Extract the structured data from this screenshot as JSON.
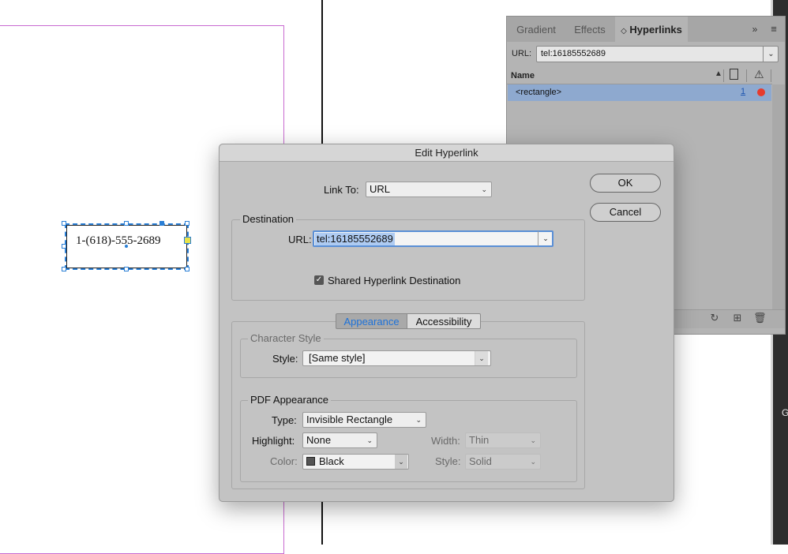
{
  "canvas": {
    "phone_text": "1-(618)-555-2689",
    "strip_char": "G"
  },
  "panel": {
    "tabs": [
      "Gradient",
      "Effects",
      "Hyperlinks"
    ],
    "active_tab_marker": "◇",
    "more_icon": "»",
    "menu_icon": "≡",
    "url_label": "URL:",
    "url_value": "tel:16185552689",
    "name_header": "Name",
    "rows": [
      {
        "name": "<rectangle>",
        "page": "1",
        "status_color": "#e63b2e"
      }
    ],
    "footer_icons": [
      "refresh-icon",
      "new-hyperlink-icon",
      "trash-icon"
    ]
  },
  "dialog": {
    "title": "Edit Hyperlink",
    "link_to_label": "Link To:",
    "link_to_value": "URL",
    "destination_title": "Destination",
    "url_label": "URL:",
    "url_value": "tel:16185552689",
    "shared_label": "Shared Hyperlink Destination",
    "shared_checked": true,
    "tabs": {
      "appearance": "Appearance",
      "accessibility": "Accessibility"
    },
    "character_style_title": "Character Style",
    "style_label": "Style:",
    "style_value": "[Same style]",
    "pdf_title": "PDF Appearance",
    "type_label": "Type:",
    "type_value": "Invisible Rectangle",
    "highlight_label": "Highlight:",
    "highlight_value": "None",
    "width_label": "Width:",
    "width_value": "Thin",
    "color_label": "Color:",
    "color_value": "Black",
    "style2_label": "Style:",
    "style2_value": "Solid",
    "ok_label": "OK",
    "cancel_label": "Cancel",
    "accent_color": "#1e72d9"
  }
}
